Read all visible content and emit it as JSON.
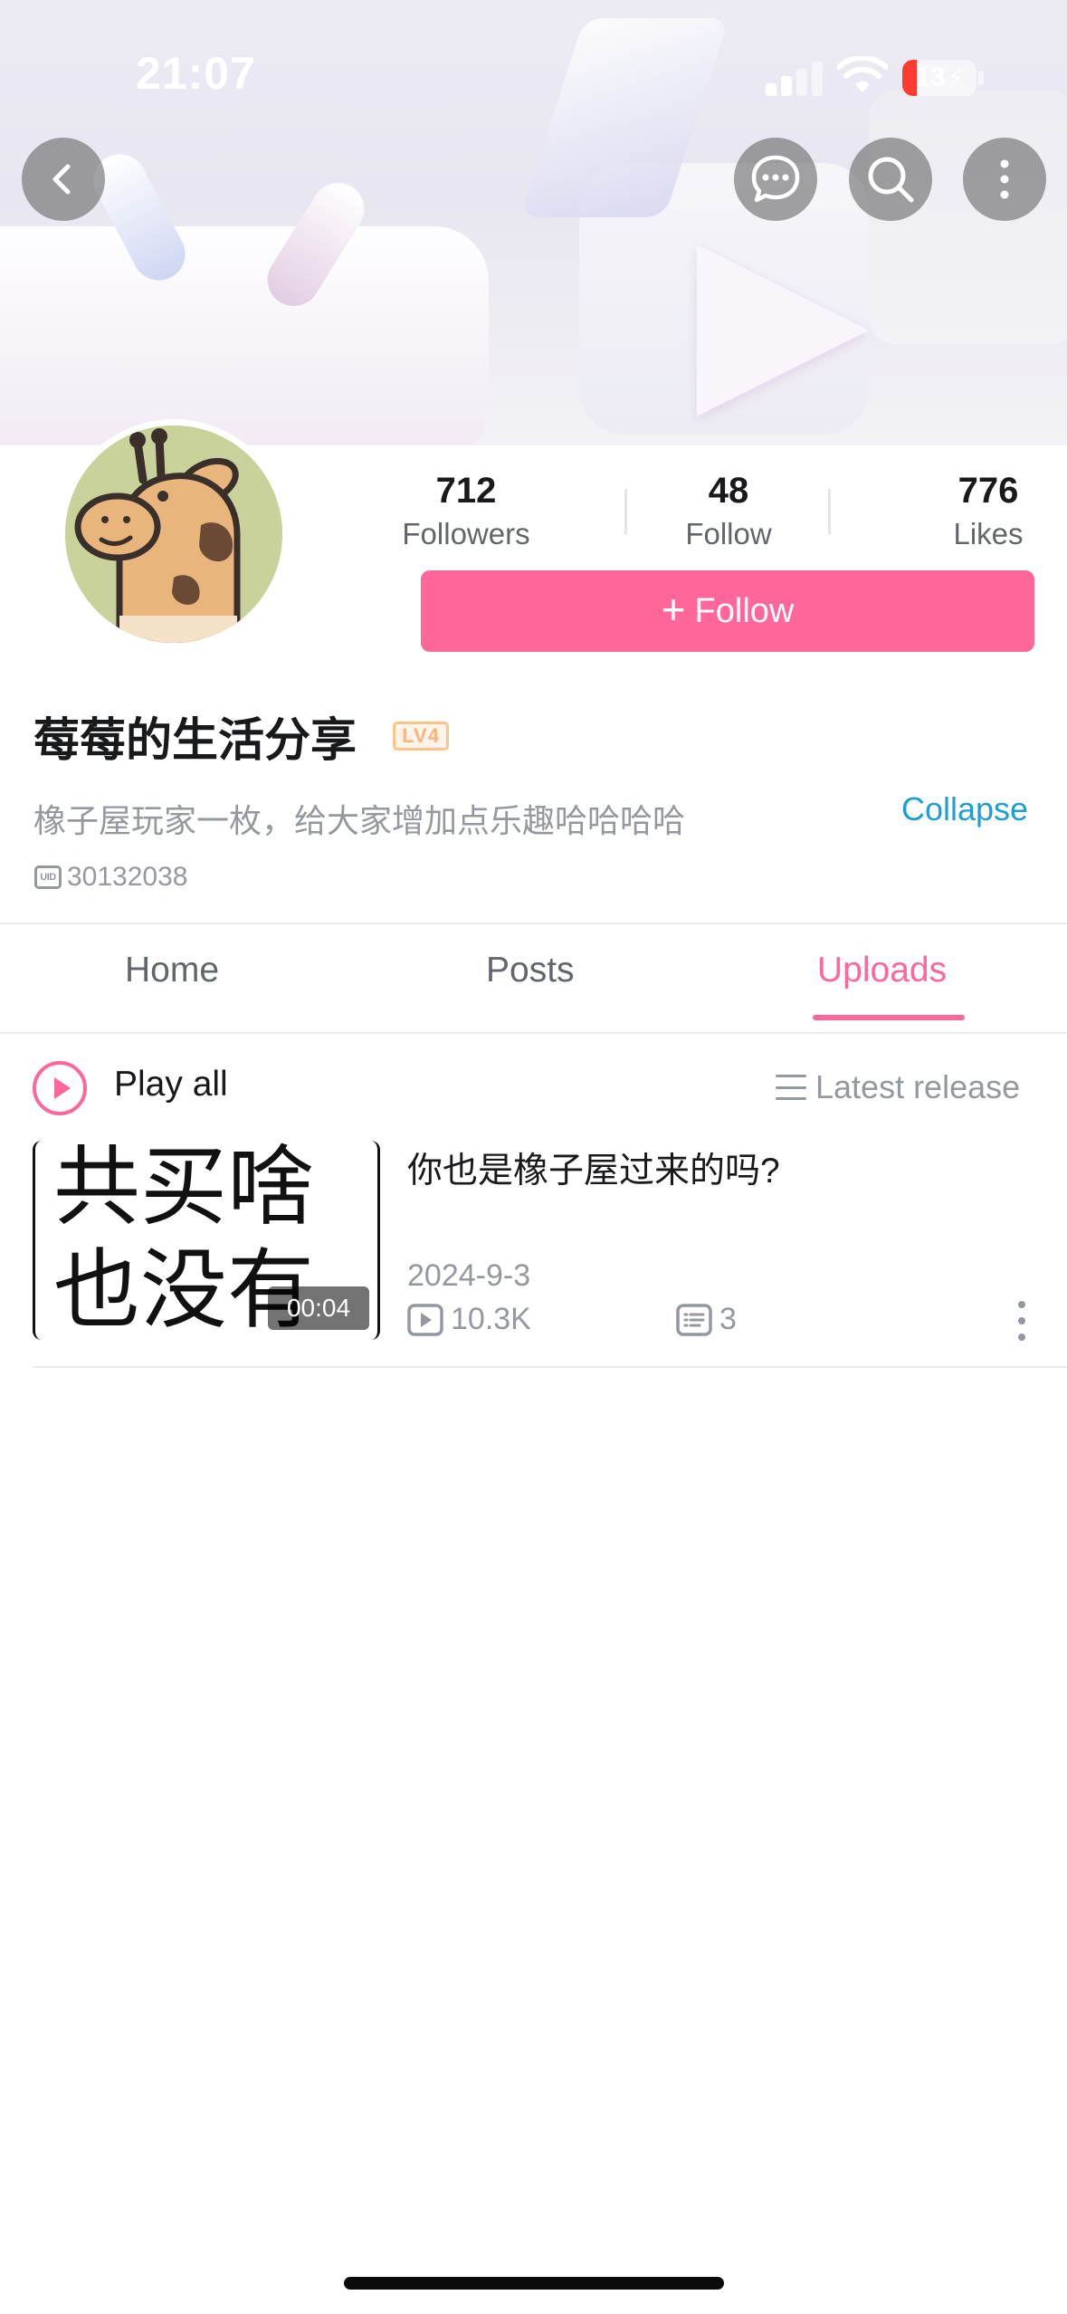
{
  "status_bar": {
    "time": "21:07",
    "battery": "13"
  },
  "header": {
    "back_icon": "chevron-left-icon",
    "actions": [
      "message-icon",
      "search-icon",
      "more-vertical-icon"
    ]
  },
  "profile": {
    "name": "莓莓的生活分享",
    "level": "LV4",
    "bio": "橡子屋玩家一枚，给大家增加点乐趣哈哈哈哈",
    "collapse_label": "Collapse",
    "uid": "30132038",
    "uid_badge": "UID",
    "follow_label": "Follow"
  },
  "stats": [
    {
      "value": "712",
      "label": "Followers"
    },
    {
      "value": "48",
      "label": "Follow"
    },
    {
      "value": "776",
      "label": "Likes"
    }
  ],
  "tabs": [
    {
      "label": "Home"
    },
    {
      "label": "Posts"
    },
    {
      "label": "Uploads",
      "active": true
    }
  ],
  "list_header": {
    "play_all": "Play all",
    "sort": "Latest release"
  },
  "videos": [
    {
      "thumb_line1": "共买啥",
      "thumb_line2": "也没有",
      "duration": "00:04",
      "title": "你也是橡子屋过来的吗?",
      "date": "2024-9-3",
      "views": "10.3K",
      "comments": "3"
    }
  ],
  "colors": {
    "accent": "#ff6699",
    "link": "#1f9ed3",
    "muted": "#9499a0"
  }
}
